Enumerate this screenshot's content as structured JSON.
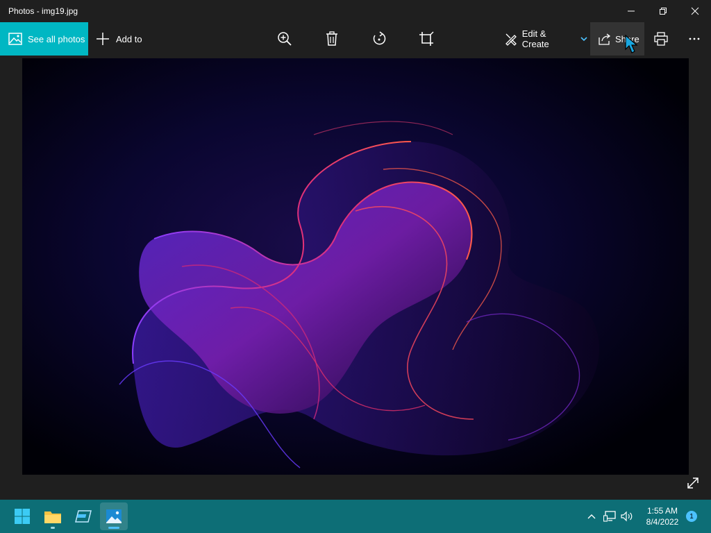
{
  "window": {
    "title": "Photos - img19.jpg"
  },
  "toolbar": {
    "see_all_label": "See all photos",
    "add_to_label": "Add to",
    "edit_create_label": "Edit & Create",
    "share_label": "Share"
  },
  "icons": {
    "photos_app": "photos-icon",
    "add": "plus-icon",
    "zoom": "zoom-in-icon",
    "delete": "trash-icon",
    "rotate": "rotate-icon",
    "crop": "crop-icon",
    "edit": "pencil-brush-icon",
    "share": "share-icon",
    "print": "printer-icon",
    "more": "more-icon",
    "fullscreen": "expand-icon"
  },
  "taskbar": {
    "time": "1:55 AM",
    "date": "8/4/2022",
    "notification_count": "1"
  },
  "colors": {
    "accent": "#00b7c3",
    "taskbar": "#0d6e76",
    "background": "#1f1f1f"
  }
}
